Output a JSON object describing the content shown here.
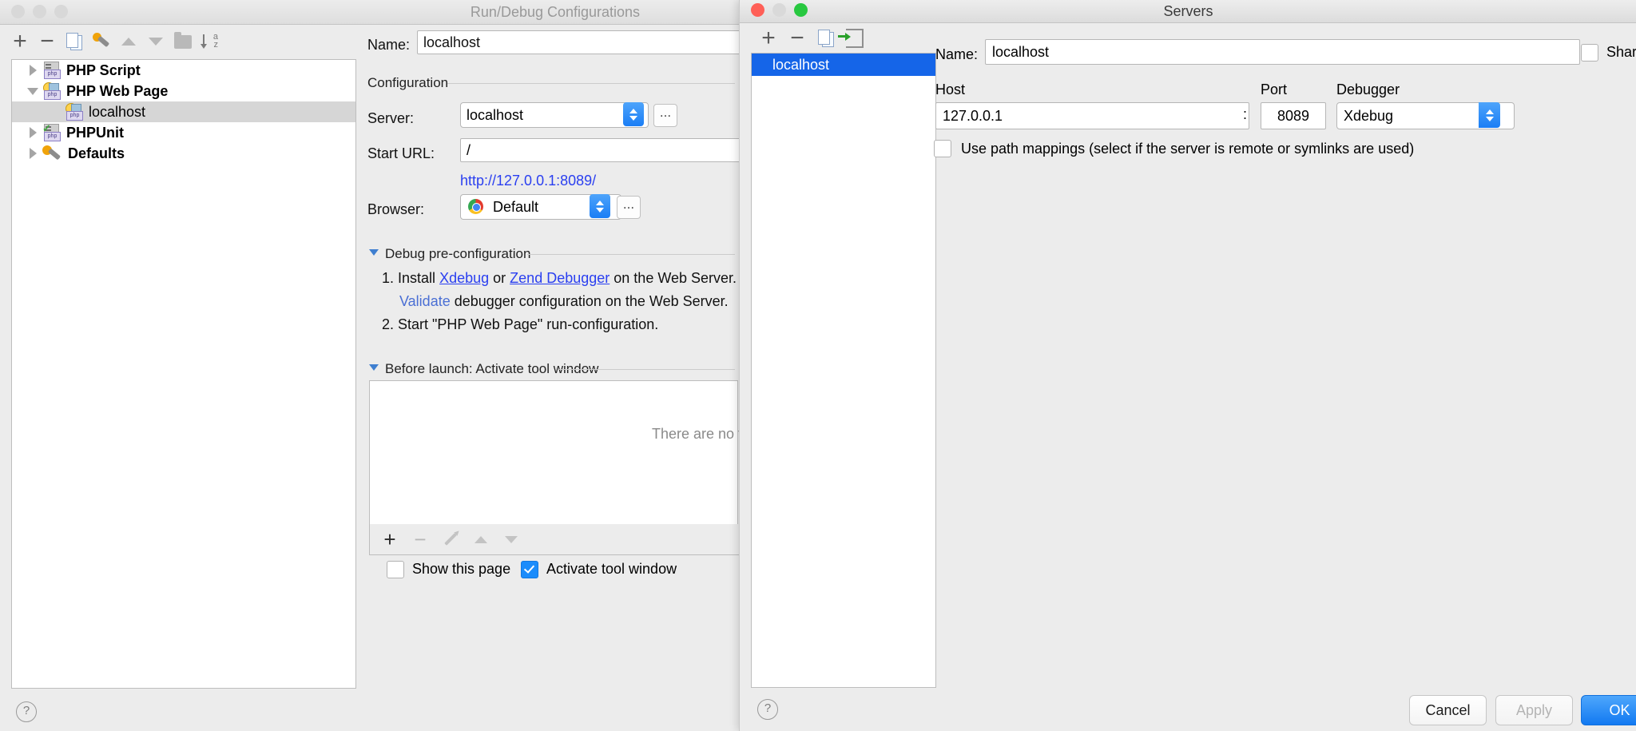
{
  "run_debug_window": {
    "title": "Run/Debug Configurations",
    "traffic": {
      "close": "close-button",
      "min": "minimize-button",
      "zoom": "zoom-button"
    },
    "toolbar": {
      "add": "+",
      "remove": "−",
      "copy": "copy-configuration",
      "edit_templates": "edit-templates",
      "move_up": "move-up",
      "move_down": "move-down",
      "folder": "create-folder",
      "sort": "sort-configurations"
    },
    "tree": [
      {
        "label": "PHP Script",
        "icon": "php-script-icon",
        "expanded": false,
        "bold": true,
        "selected": false,
        "indent": 0
      },
      {
        "label": "PHP Web Page",
        "icon": "php-web-page-icon",
        "expanded": true,
        "bold": true,
        "selected": false,
        "indent": 0
      },
      {
        "label": "localhost",
        "icon": "php-web-page-icon",
        "expanded": null,
        "bold": false,
        "selected": true,
        "indent": 1
      },
      {
        "label": "PHPUnit",
        "icon": "phpunit-icon",
        "expanded": false,
        "bold": true,
        "selected": false,
        "indent": 0
      },
      {
        "label": "Defaults",
        "icon": "defaults-icon",
        "expanded": false,
        "bold": true,
        "selected": false,
        "indent": 0
      }
    ],
    "form": {
      "name_label": "Name:",
      "name_value": "localhost",
      "configuration_section": "Configuration",
      "server_label": "Server:",
      "server_value": "localhost",
      "server_browse": "...",
      "start_url_label": "Start URL:",
      "start_url_value": "/",
      "url_preview": "http://127.0.0.1:8089/",
      "browser_label": "Browser:",
      "browser_value": "Default",
      "browser_browse": "..."
    },
    "debug_pre_configuration": {
      "section": "Debug pre-configuration",
      "step1_prefix": "1. Install",
      "step1_link1": "Xdebug",
      "step1_mid": "or",
      "step1_link2": "Zend Debugger",
      "step1_suffix": "on the Web Server.",
      "validate_link": "Validate",
      "validate_suffix": "debugger configuration on the Web Server.",
      "step2": "2. Start \"PHP Web Page\" run-configuration."
    },
    "before_launch": {
      "section": "Before launch: Activate tool window",
      "empty_text": "There are no ta",
      "toolbar": {
        "add": "+",
        "remove": "−",
        "edit": "edit-task",
        "up": "move-task-up",
        "down": "move-task-down"
      },
      "show_page_label": "Show this page",
      "show_page_checked": false,
      "activate_tool_label": "Activate tool window",
      "activate_tool_checked": true
    },
    "help": "?"
  },
  "servers_window": {
    "title": "Servers",
    "toolbar": {
      "add": "+",
      "remove": "−",
      "copy": "copy-server",
      "import": "import-server"
    },
    "list": [
      {
        "label": "localhost",
        "selected": true
      }
    ],
    "form": {
      "name_label": "Name:",
      "name_value": "localhost",
      "shared_label": "Shared",
      "shared_checked": false,
      "host_label": "Host",
      "host_value": "127.0.0.1",
      "colon": ":",
      "port_label": "Port",
      "port_value": "8089",
      "debugger_label": "Debugger",
      "debugger_value": "Xdebug",
      "path_mappings_label": "Use path mappings (select if the server is remote or symlinks are used)",
      "path_mappings_checked": false
    },
    "buttons": {
      "cancel": "Cancel",
      "apply": "Apply",
      "ok": "OK"
    },
    "help": "?"
  },
  "colors": {
    "selection_blue": "#1565e8",
    "accent_blue": "#1b8cfb",
    "link_blue": "#2a3ff0",
    "window_bg": "#ececec"
  }
}
